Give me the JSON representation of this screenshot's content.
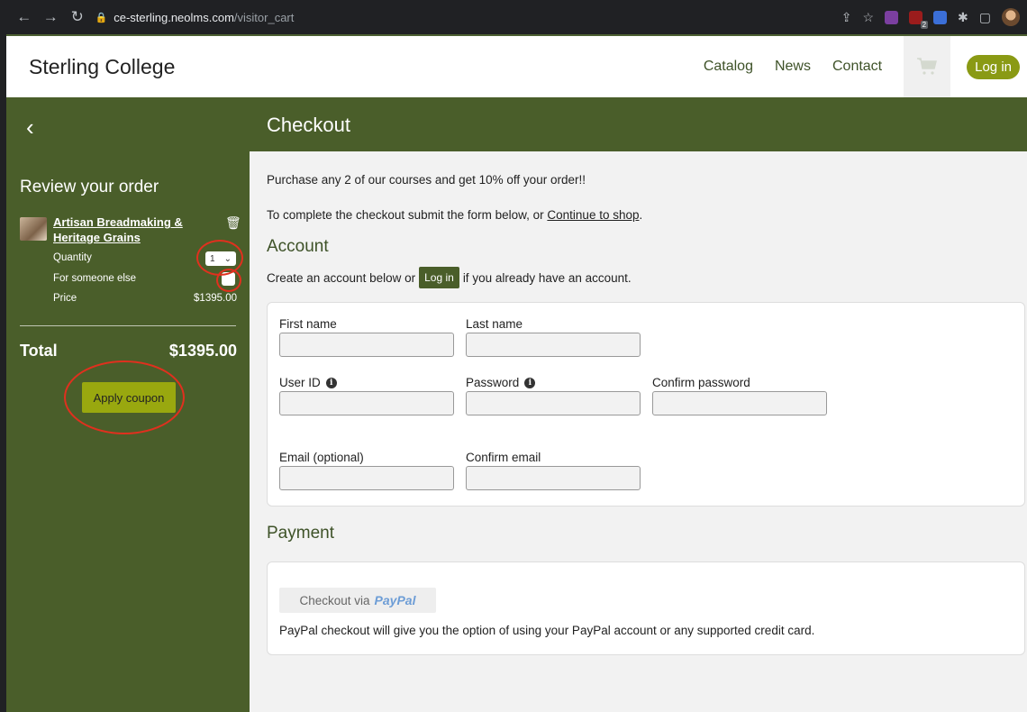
{
  "browser": {
    "url_host": "ce-sterling.neolms.com",
    "url_path": "/visitor_cart",
    "extension_badge": "2"
  },
  "header": {
    "brand": "Sterling College",
    "nav": [
      "Catalog",
      "News",
      "Contact"
    ],
    "login": "Log in"
  },
  "sidebar": {
    "review_title": "Review your order",
    "course_title": "Artisan Breadmaking & Heritage Grains",
    "quantity_label": "Quantity",
    "quantity_value": "1",
    "someone_label": "For someone else",
    "price_label": "Price",
    "price_value": "$1395.00",
    "total_label": "Total",
    "total_value": "$1395.00",
    "coupon_button": "Apply coupon"
  },
  "checkout": {
    "title": "Checkout",
    "promo": "Purchase any 2 of our courses and get 10% off your order!!",
    "instructions_prefix": "To complete the checkout submit the form below, or ",
    "continue_link": "Continue to shop",
    "instructions_suffix": ".",
    "account_title": "Account",
    "create_prefix": "Create an account below or",
    "inline_login": "Log in",
    "create_suffix": "if you already have an account.",
    "fields": {
      "first_name": "First name",
      "last_name": "Last name",
      "user_id": "User ID",
      "password": "Password",
      "confirm_password": "Confirm password",
      "email": "Email (optional)",
      "confirm_email": "Confirm email"
    },
    "payment_title": "Payment",
    "paypal_prefix": "Checkout via",
    "paypal_brand": "PayPal",
    "paypal_note": "PayPal checkout will give you the option of using your PayPal account or any supported credit card."
  },
  "colors": {
    "primary_green": "#4a5e2a",
    "accent_olive": "#99a80f",
    "annotation_red": "#e0301e"
  }
}
